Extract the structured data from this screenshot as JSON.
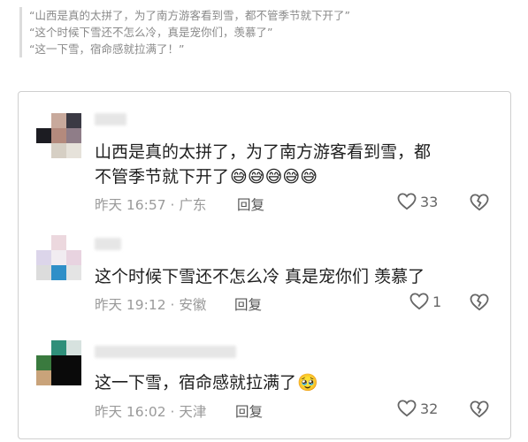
{
  "quote": {
    "lines": [
      "“山西是真的太拼了，为了南方游客看到雪，都不管季节就下开了”",
      "“这个时候下雪还不怎么冷，真是宠你们，羡慕了”",
      "“这一下雪，宿命感就拉满了！”"
    ]
  },
  "comments": [
    {
      "text_line1": "山西是真的太拼了，为了南方游客看到雪，都",
      "text_line2": "不管季节就下开了",
      "emoji": "😅😅😅😅😅",
      "meta": "昨天 16:57 · 广东",
      "reply_label": "回复",
      "likes": "33"
    },
    {
      "text_line1": "这个时候下雪还不怎么冷  真是宠你们  羡慕了",
      "meta": "昨天 19:12 · 安徽",
      "reply_label": "回复",
      "likes": "1"
    },
    {
      "text_line1": "这一下雪，宿命感就拉满了",
      "emoji": "🥹",
      "meta": "昨天 16:02 · 天津",
      "reply_label": "回复",
      "likes": "32"
    }
  ],
  "colors": {
    "heart": "#666666",
    "meta": "#9a9a9a"
  },
  "icons": {
    "like": "heart-outline-icon",
    "dislike": "broken-heart-icon"
  }
}
